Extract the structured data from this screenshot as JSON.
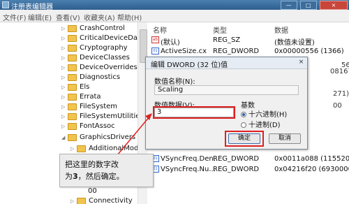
{
  "window": {
    "title": "注册表编辑器",
    "controls": [
      "—",
      "□",
      "×"
    ]
  },
  "menu": [
    "文件(F)",
    "编辑(E)",
    "查看(V)",
    "收藏夹(A)",
    "帮助(H)"
  ],
  "tree": {
    "items": [
      {
        "label": "CrashControl"
      },
      {
        "label": "CriticalDeviceDatabase"
      },
      {
        "label": "Cryptography"
      },
      {
        "label": "DeviceClasses"
      },
      {
        "label": "DeviceOverrides"
      },
      {
        "label": "Diagnostics"
      },
      {
        "label": "Els"
      },
      {
        "label": "Errata"
      },
      {
        "label": "FileSystem"
      },
      {
        "label": "FileSystemUtilities"
      },
      {
        "label": "FontAssoc"
      },
      {
        "label": "GraphicsDrivers"
      },
      {
        "label": "AdditionalModeLis"
      },
      {
        "label": "00"
      },
      {
        "label": "Connectivity"
      }
    ]
  },
  "values_pane": {
    "headers": {
      "name": "名称",
      "type": "类型",
      "data": "数据"
    },
    "rows": [
      {
        "name": "(默认)",
        "type": "REG_SZ",
        "data": "(数值未设置)"
      },
      {
        "name": "ActiveSize.cx",
        "type": "REG_DWORD",
        "data": "0x00000556 (1366)"
      },
      {
        "name": "VSyncFreq.Den...",
        "type": "REG_DWORD",
        "data": "0x0011a088 (1155208)"
      },
      {
        "name": "VSyncFreq.Nu...",
        "type": "REG_DWORD",
        "data": "0x04216f20 (69300000)"
      }
    ],
    "partial_values": [
      "56",
      "08167)",
      "271)",
      "00"
    ]
  },
  "dialog": {
    "title": "编辑 DWORD (32 位)值",
    "close": "×",
    "name_label": "数值名称(N):",
    "name_value": "Scaling",
    "data_label": "数值数据(V):",
    "data_value": "3",
    "base_label": "基数",
    "base_options": [
      {
        "label": "十六进制(H)",
        "selected": true
      },
      {
        "label": "十进制(D)",
        "selected": false
      }
    ],
    "ok_label": "确定",
    "cancel_label": "取消"
  },
  "callout": {
    "line1": "把这里的数字改",
    "line2_prefix": "为",
    "line2_bold": "3",
    "line2_suffix": "，然后确定。"
  },
  "colors": {
    "highlight_red": "#e02020",
    "titlebar": "#2e5f8e",
    "close_button": "#c8453a"
  }
}
